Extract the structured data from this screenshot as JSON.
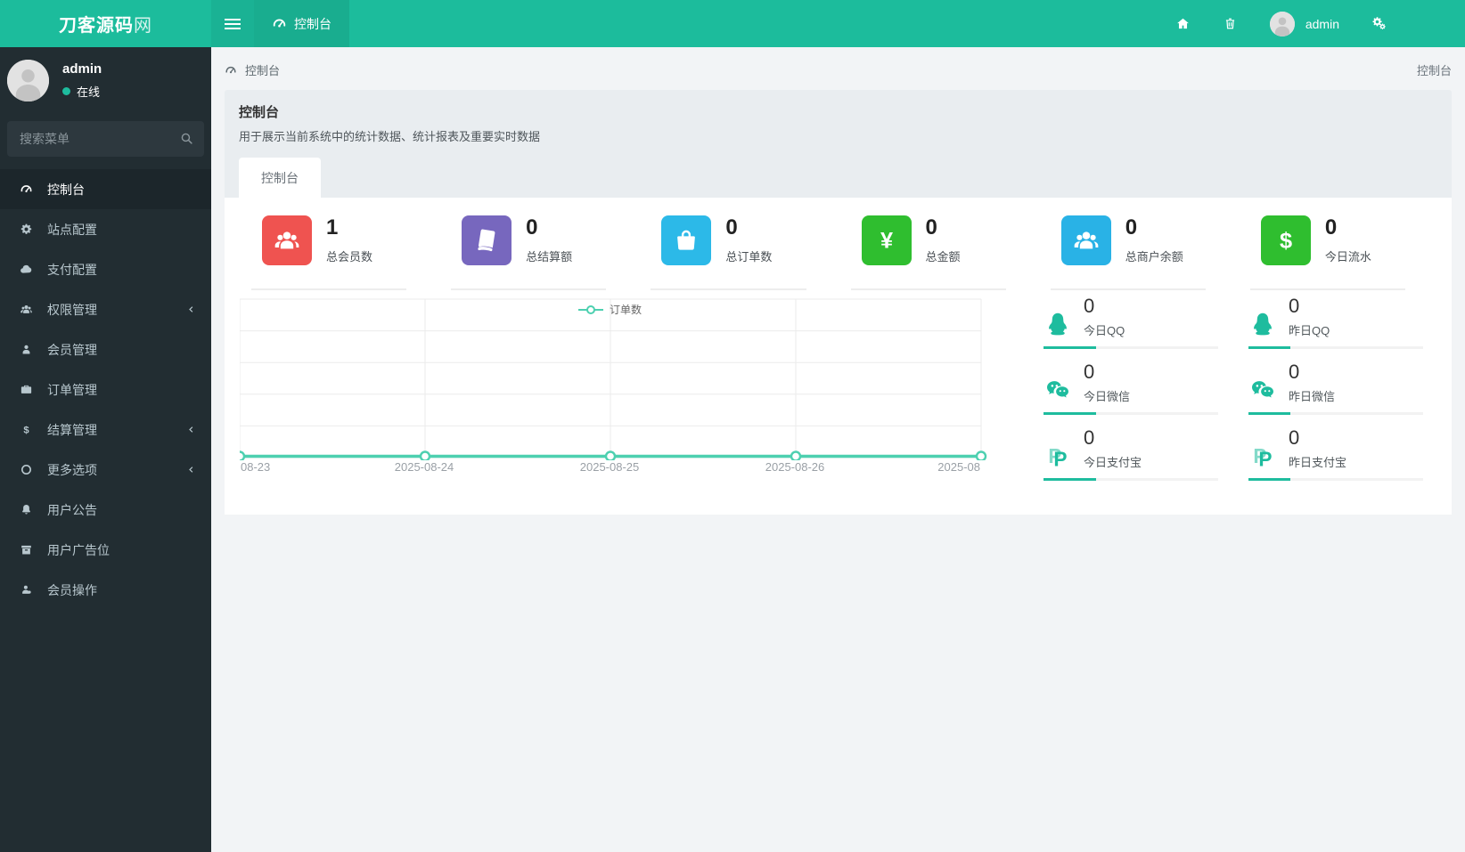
{
  "app": {
    "brand_bold": "刀客源码",
    "brand_light": "网"
  },
  "colors": {
    "header_green": "#1cbc9c",
    "sidebar_dark": "#222d32",
    "accent_teal": "#1ebc9e",
    "chart_line": "#4dd0b0",
    "page_bg": "#f2f4f6"
  },
  "header": {
    "nav_tab": {
      "label": "控制台",
      "icon": "dashboard-icon"
    },
    "right": {
      "icons": [
        "home-icon",
        "trash-icon",
        "cogs-icon"
      ],
      "user_name": "admin"
    }
  },
  "sidebar": {
    "user": {
      "name": "admin",
      "status": "在线"
    },
    "search": {
      "placeholder": "搜索菜单"
    },
    "menu": [
      {
        "id": "dashboard",
        "label": "控制台",
        "icon": "dashboard-icon",
        "active": true,
        "has_children": false
      },
      {
        "id": "site-config",
        "label": "站点配置",
        "icon": "gear-icon",
        "active": false,
        "has_children": false
      },
      {
        "id": "payment-config",
        "label": "支付配置",
        "icon": "cloud-icon",
        "active": false,
        "has_children": false
      },
      {
        "id": "permission",
        "label": "权限管理",
        "icon": "users-icon",
        "active": false,
        "has_children": true
      },
      {
        "id": "member",
        "label": "会员管理",
        "icon": "user-icon",
        "active": false,
        "has_children": false
      },
      {
        "id": "order",
        "label": "订单管理",
        "icon": "briefcase-icon",
        "active": false,
        "has_children": false
      },
      {
        "id": "settlement",
        "label": "结算管理",
        "icon": "dollar-icon",
        "active": false,
        "has_children": true
      },
      {
        "id": "more",
        "label": "更多选项",
        "icon": "circle-o-icon",
        "active": false,
        "has_children": true
      },
      {
        "id": "notice",
        "label": "用户公告",
        "icon": "bell-icon",
        "active": false,
        "has_children": false
      },
      {
        "id": "ad-slot",
        "label": "用户广告位",
        "icon": "archive-icon",
        "active": false,
        "has_children": false
      },
      {
        "id": "member-ops",
        "label": "会员操作",
        "icon": "member-ops-icon",
        "active": false,
        "has_children": false
      }
    ]
  },
  "breadcrumb": {
    "icon": "dashboard-icon",
    "left": "控制台",
    "right": "控制台"
  },
  "panel": {
    "title": "控制台",
    "description": "用于展示当前系统中的统计数据、统计报表及重要实时数据",
    "tab": "控制台"
  },
  "stats": [
    {
      "value": "1",
      "label": "总会员数",
      "icon": "users-icon",
      "color": "#ef5350"
    },
    {
      "value": "0",
      "label": "总结算额",
      "icon": "book-icon",
      "color": "#7767be"
    },
    {
      "value": "0",
      "label": "总订单数",
      "icon": "shopping-bag-icon",
      "color": "#2cb9e8"
    },
    {
      "value": "0",
      "label": "总金额",
      "icon": "yuan-icon",
      "color": "#2fbe2f"
    },
    {
      "value": "0",
      "label": "总商户余额",
      "icon": "users-icon",
      "color": "#29b2e6"
    },
    {
      "value": "0",
      "label": "今日流水",
      "icon": "dollar-sign-icon",
      "color": "#2fbe2f"
    }
  ],
  "mini_stats": {
    "columns": [
      {
        "name": "today",
        "items": [
          {
            "value": "0",
            "label": "今日QQ",
            "icon": "qq-icon",
            "bar_pct": 30
          },
          {
            "value": "0",
            "label": "今日微信",
            "icon": "wechat-icon",
            "bar_pct": 30
          },
          {
            "value": "0",
            "label": "今日支付宝",
            "icon": "paypal-icon",
            "bar_pct": 30
          }
        ]
      },
      {
        "name": "yesterday",
        "items": [
          {
            "value": "0",
            "label": "昨日QQ",
            "icon": "qq-icon",
            "bar_pct": 24
          },
          {
            "value": "0",
            "label": "昨日微信",
            "icon": "wechat-icon",
            "bar_pct": 24
          },
          {
            "value": "0",
            "label": "昨日支付宝",
            "icon": "paypal-icon",
            "bar_pct": 24
          }
        ]
      }
    ]
  },
  "chart_data": {
    "type": "line",
    "series": [
      {
        "name": "订单数",
        "values": [
          0,
          0,
          0,
          0,
          0
        ]
      }
    ],
    "x_labels": [
      "08-23",
      "2025-08-24",
      "2025-08-25",
      "2025-08-26",
      "2025-08"
    ],
    "y_axis_labels": [],
    "grid": true,
    "y_gridlines": 5,
    "legend_position": "top-center",
    "line_color": "#4dd0b0"
  }
}
